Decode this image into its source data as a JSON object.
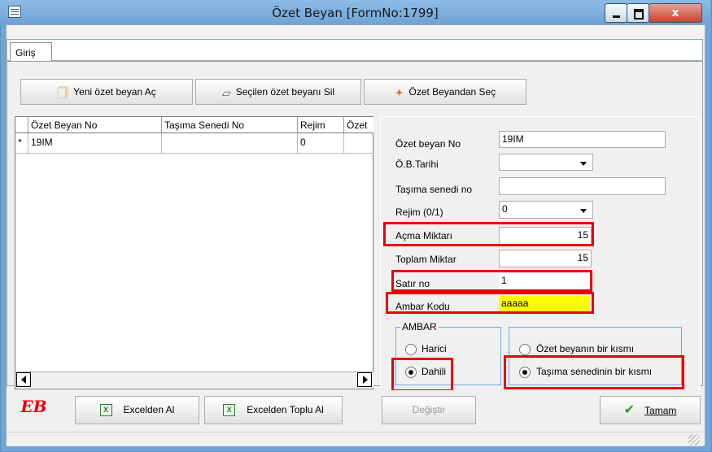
{
  "window": {
    "title": "Özet Beyan [FormNo:1799]",
    "close_glyph": "x"
  },
  "tabs": [
    {
      "label": "Giriş",
      "active": true
    }
  ],
  "toolbar": {
    "new_label": "Yeni özet beyan Aç",
    "delete_label": "Seçilen özet beyanı Sil",
    "select_label": "Özet Beyandan Seç",
    "new_icon": "new-document-icon",
    "delete_icon": "eraser-icon",
    "select_icon": "select-icon"
  },
  "grid": {
    "columns": [
      "Özet Beyan No",
      "Taşıma Senedi No",
      "Rejim",
      "Özet"
    ],
    "rows": [
      {
        "marker": "*",
        "cells": [
          "19IM",
          "",
          "0",
          ""
        ]
      }
    ]
  },
  "form": {
    "ozet_beyan_no": {
      "label": "Özet beyan No",
      "value": "19IM"
    },
    "ob_tarihi": {
      "label": "Ö.B.Tarihi",
      "value": ""
    },
    "tasima_senedi_no": {
      "label": "Taşıma senedi no",
      "value": ""
    },
    "rejim": {
      "label": "Rejim  (0/1)",
      "value": "0"
    },
    "acma_miktari": {
      "label": "Açma Miktarı",
      "value": "15"
    },
    "toplam_miktar": {
      "label": "Toplam Miktar",
      "value": "15"
    },
    "satir_no": {
      "label": "Satır no",
      "value": "1"
    },
    "ambar_kodu": {
      "label": "Ambar Kodu",
      "value": "aaaaa"
    }
  },
  "ambar_group": {
    "title": "AMBAR",
    "options": [
      {
        "label": "Harici",
        "selected": false
      },
      {
        "label": "Dahili",
        "selected": true
      }
    ]
  },
  "kisim_group": {
    "options": [
      {
        "label": "Özet beyanın bir kısmı",
        "selected": false
      },
      {
        "label": "Taşıma senedinin bir kısmı",
        "selected": true
      }
    ]
  },
  "bottom": {
    "logo": "EB",
    "excel_label": "Excelden Al",
    "excel_bulk_label": "Excelden Toplu Al",
    "change_label": "Değiştir",
    "ok_label": "Tamam"
  },
  "colors": {
    "highlight_red": "#e8000a",
    "ambar_kodu_bg": "#ffff00",
    "titlebar": "#6ea3d4"
  }
}
